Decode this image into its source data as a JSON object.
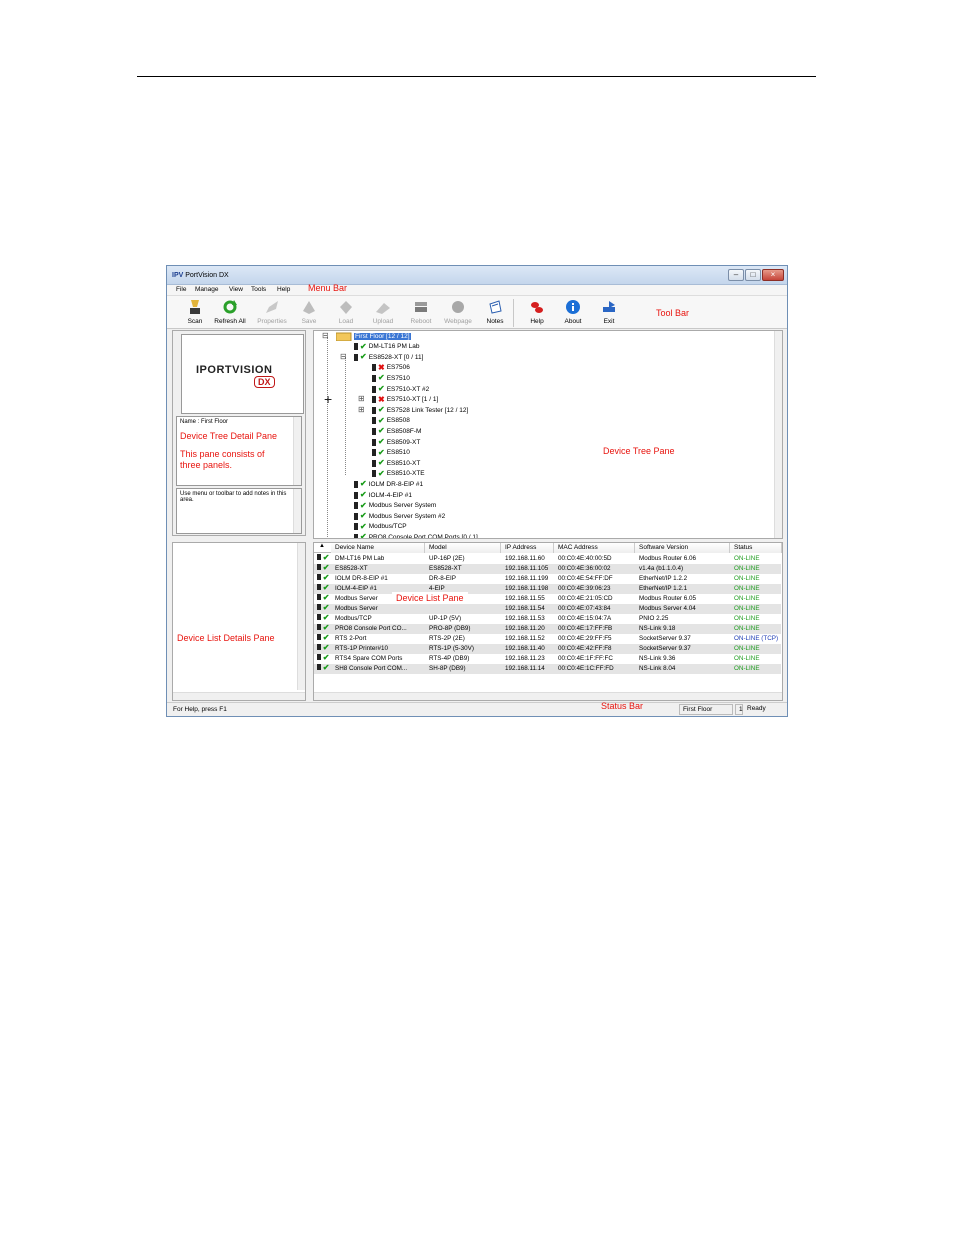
{
  "window": {
    "title": "PortVision DX",
    "app_icon": "IPV"
  },
  "menu": {
    "file": "File",
    "manage": "Manage",
    "view": "View",
    "tools": "Tools",
    "help": "Help"
  },
  "annotations": {
    "menu_bar": "Menu Bar",
    "tool_bar": "Tool Bar",
    "device_tree_detail_pane": "Device Tree Detail Pane",
    "three_panels": "This pane consists of three panels.",
    "device_tree_pane": "Device Tree Pane",
    "device_list_pane": "Device List Pane",
    "device_list_details_pane": "Device List Details Pane",
    "status_bar": "Status Bar"
  },
  "toolbar": {
    "scan": "Scan",
    "refresh_all": "Refresh All",
    "properties": "Properties",
    "save": "Save",
    "load": "Load",
    "upload": "Upload",
    "reboot": "Reboot",
    "webpage": "Webpage",
    "notes": "Notes",
    "help": "Help",
    "about": "About",
    "exit": "Exit"
  },
  "logo": {
    "text": "IPORTVISION",
    "sub": "DX"
  },
  "detail": {
    "name": "Name : First Floor",
    "notes_hint": "Use menu or toolbar to add notes in this area."
  },
  "tree": [
    {
      "label": "First Floor [12 / 12]"
    },
    {
      "label": "DM-LT16 PM Lab"
    },
    {
      "label": "ES8528-XT [0 / 11]"
    },
    {
      "label": "ES7506"
    },
    {
      "label": "ES7510"
    },
    {
      "label": "ES7510-XT #2"
    },
    {
      "label": "ES7510-XT [1 / 1]"
    },
    {
      "label": "ES7528 Link Tester [12 / 12]"
    },
    {
      "label": "ES8508"
    },
    {
      "label": "ES8508F-M"
    },
    {
      "label": "ES8509-XT"
    },
    {
      "label": "ES8510"
    },
    {
      "label": "ES8510-XT"
    },
    {
      "label": "ES8510-XTE"
    },
    {
      "label": "IOLM DR-8-EIP #1"
    },
    {
      "label": "IOLM-4-EIP #1"
    },
    {
      "label": "Modbus Server System"
    },
    {
      "label": "Modbus Server System #2"
    },
    {
      "label": "Modbus/TCP"
    },
    {
      "label": "PRO8 Console Port COM Ports [0 / 1]"
    }
  ],
  "list": {
    "columns": [
      "Device Name",
      "Model",
      "IP Address",
      "MAC Address",
      "Software Version",
      "Status"
    ],
    "rows": [
      {
        "name": "DM-LT16 PM Lab",
        "model": "UP-16P (2E)",
        "ip": "192.168.11.60",
        "mac": "00:C0:4E:40:00:5D",
        "sw": "Modbus Router 6.06",
        "status": "ON-LINE"
      },
      {
        "name": "ES8528-XT",
        "model": "ES8528-XT",
        "ip": "192.168.11.105",
        "mac": "00:C0:4E:36:00:02",
        "sw": "v1.4a (b1.1.0.4)",
        "status": "ON-LINE"
      },
      {
        "name": "IOLM DR-8-EIP #1",
        "model": "DR-8-EIP",
        "ip": "192.168.11.199",
        "mac": "00:C0:4E:54:FF:DF",
        "sw": "EtherNet/IP 1.2.2",
        "status": "ON-LINE"
      },
      {
        "name": "IOLM-4-EIP #1",
        "model": "4-EIP",
        "ip": "192.168.11.198",
        "mac": "00:C0:4E:39:06:23",
        "sw": "EtherNet/IP 1.2.1",
        "status": "ON-LINE"
      },
      {
        "name": "Modbus Server",
        "model": "",
        "ip": "192.168.11.55",
        "mac": "00:C0:4E:21:05:CD",
        "sw": "Modbus Router 6.05",
        "status": "ON-LINE"
      },
      {
        "name": "Modbus Server",
        "model": "",
        "ip": "192.168.11.54",
        "mac": "00:C0:4E:07:43:84",
        "sw": "Modbus Server 4.04",
        "status": "ON-LINE"
      },
      {
        "name": "Modbus/TCP",
        "model": "UP-1P (5V)",
        "ip": "192.168.11.53",
        "mac": "00:C0:4E:15:04:7A",
        "sw": "PNIO 2.25",
        "status": "ON-LINE"
      },
      {
        "name": "PRO8 Console Port CO...",
        "model": "PRO-8P (DB9)",
        "ip": "192.168.11.20",
        "mac": "00:C0:4E:17:FF:FB",
        "sw": "NS-Link 9.18",
        "status": "ON-LINE"
      },
      {
        "name": "RTS 2-Port",
        "model": "RTS-2P (2E)",
        "ip": "192.168.11.52",
        "mac": "00:C0:4E:29:FF:F5",
        "sw": "SocketServer 9.37",
        "status": "ON-LINE (TCP)"
      },
      {
        "name": "RTS-1P Printer#10",
        "model": "RTS-1P (5-30V)",
        "ip": "192.168.11.40",
        "mac": "00:C0:4E:42:FF:F8",
        "sw": "SocketServer 9.37",
        "status": "ON-LINE"
      },
      {
        "name": "RTS4 Spare COM Ports",
        "model": "RTS-4P (DB9)",
        "ip": "192.168.11.23",
        "mac": "00:C0:4E:1F:FF:FC",
        "sw": "NS-Link 9.36",
        "status": "ON-LINE"
      },
      {
        "name": "SH8 Console Port COM...",
        "model": "SH-8P (DB9)",
        "ip": "192.168.11.14",
        "mac": "00:C0:4E:1C:FF:FD",
        "sw": "NS-Link 8.04",
        "status": "ON-LINE"
      }
    ]
  },
  "status": {
    "help": "For Help, press F1",
    "location": "First Floor",
    "count": "1",
    "ready": "Ready"
  }
}
